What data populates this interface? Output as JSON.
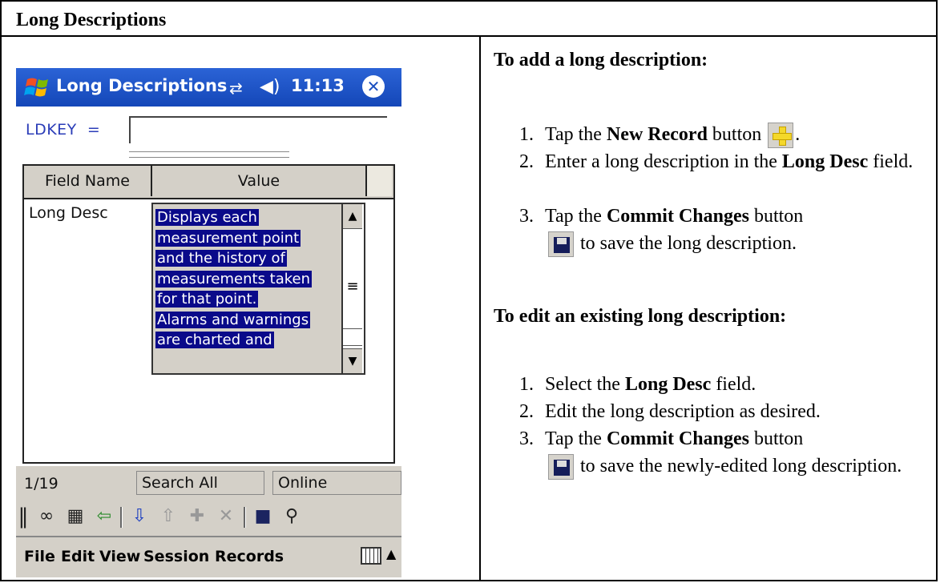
{
  "document": {
    "header_title": "Long Descriptions"
  },
  "device": {
    "title": "Long Descriptions",
    "time": "11:13",
    "icons": {
      "start": "windows-flag-icon",
      "connectivity": "connectivity-arrows-icon",
      "volume": "speaker-icon",
      "close": "close-icon"
    },
    "ldkey_label": "LDKEY",
    "ldkey_operator": "=",
    "ldkey_value": "",
    "grid": {
      "columns": [
        "Field Name",
        "Value"
      ],
      "rows": [
        {
          "field": "Long Desc",
          "value": "Displays each measurement point and the history of measurements taken for that point. Alarms and warnings are charted and"
        }
      ]
    },
    "value_lines": [
      "Displays each",
      "measurement point",
      "and the history of",
      "measurements taken",
      "for that point.",
      "Alarms and warnings",
      "are charted and"
    ],
    "status": {
      "record": "1/19",
      "search": "Search All",
      "mode": "Online"
    },
    "toolbar_icons": [
      "grip-icon",
      "glasses-icon",
      "table-icon",
      "back-arrow-icon",
      "insert-record-icon",
      "append-record-icon",
      "new-record-icon",
      "delete-icon",
      "save-icon",
      "search-icon"
    ],
    "menu": [
      "File",
      "Edit",
      "View",
      "Session",
      "Records"
    ],
    "colors": {
      "titlebar": "#1a4fc0",
      "selection": "#0a0a8a",
      "chrome": "#d4d0c8",
      "label": "#2b3db8"
    }
  },
  "instructions": {
    "add": {
      "heading": "To add a long description:",
      "steps": [
        {
          "num": "1.",
          "pre": "Tap the ",
          "bold": "New Record",
          "post": " button",
          "after_icon": "."
        },
        {
          "num": "2.",
          "pre": "Enter a long description in the ",
          "bold": "Long Desc",
          "post": " field."
        },
        {
          "num": "3.",
          "pre": "Tap the ",
          "bold": "Commit Changes",
          "post": " button",
          "after_icon": " to save the long description."
        }
      ]
    },
    "edit": {
      "heading": "To edit an existing long description:",
      "steps": [
        {
          "num": "1.",
          "pre": "Select the ",
          "bold": "Long Desc",
          "post": " field."
        },
        {
          "num": "2.",
          "text": "Edit the long description as desired."
        },
        {
          "num": "3.",
          "pre": "Tap the ",
          "bold": "Commit Changes",
          "post": " button",
          "after_icon": " to save the newly-edited long description."
        }
      ]
    }
  }
}
